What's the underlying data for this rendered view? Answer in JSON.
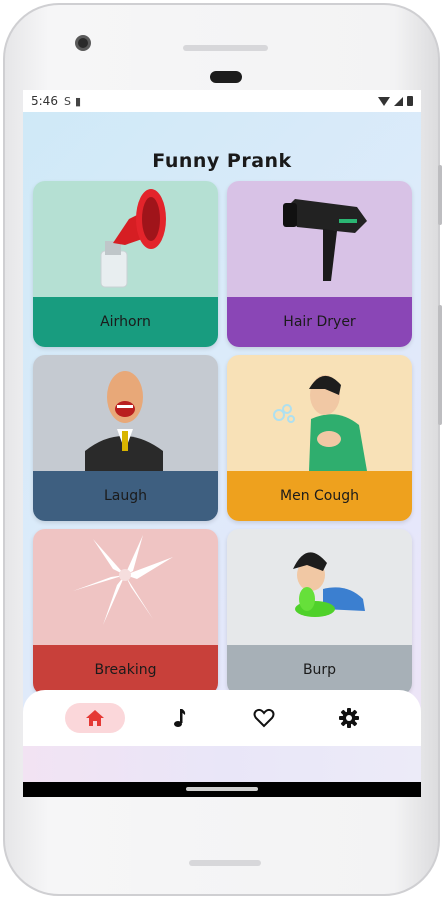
{
  "status_bar": {
    "time": "5:46"
  },
  "app": {
    "title": "Funny Prank"
  },
  "colors": {
    "airhorn_bg": "#b5e0d3",
    "airhorn_band": "#189c7f",
    "hairdryer_bg": "#d8c2e6",
    "hairdryer_band": "#8a46b6",
    "laugh_bg": "#c5cad1",
    "laugh_band": "#3e5f80",
    "cough_bg": "#f8e1b7",
    "cough_band": "#eea11e",
    "breaking_bg": "#efc4c3",
    "breaking_band": "#c8403a",
    "burp_bg": "#e6e8ea",
    "burp_band": "#a7b0b7",
    "nav_active": "#fbd7da",
    "nav_home": "#e53935"
  },
  "cards": [
    {
      "label": "Airhorn"
    },
    {
      "label": "Hair Dryer"
    },
    {
      "label": "Laugh"
    },
    {
      "label": "Men Cough"
    },
    {
      "label": "Breaking"
    },
    {
      "label": "Burp"
    }
  ],
  "bottom_nav": [
    {
      "icon": "home-icon",
      "active": true
    },
    {
      "icon": "music-note-icon",
      "active": false
    },
    {
      "icon": "heart-icon",
      "active": false
    },
    {
      "icon": "settings-icon",
      "active": false
    }
  ]
}
